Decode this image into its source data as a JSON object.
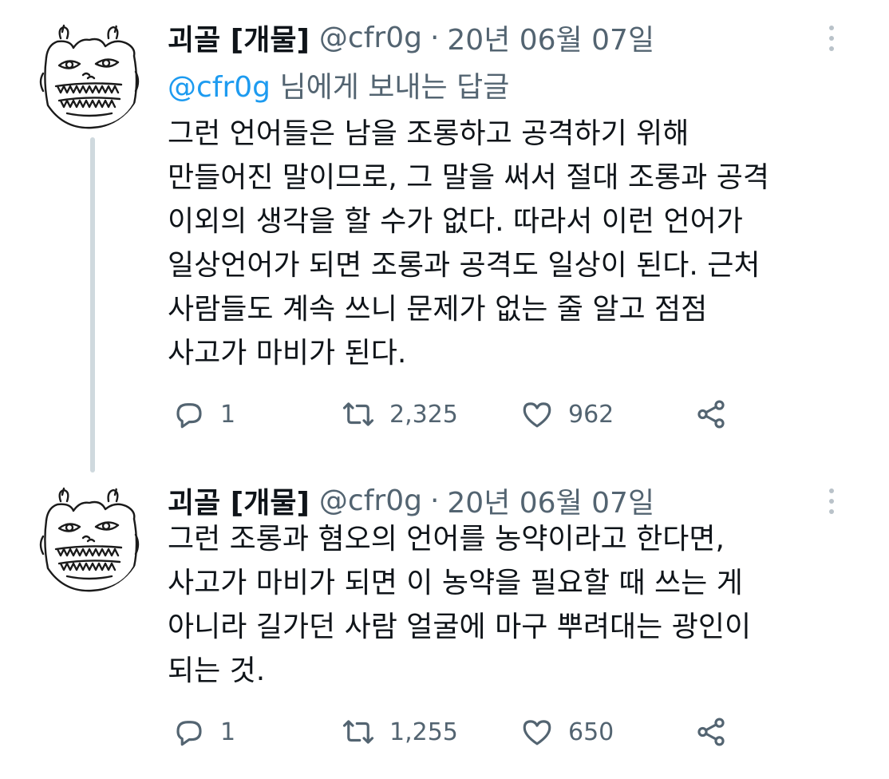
{
  "tweets": [
    {
      "display_name": "괴골 [개물]",
      "handle": "@cfr0g",
      "separator": "·",
      "date": "20년 06월 07일",
      "reply_to": {
        "mention": "@cfr0g",
        "suffix": "님에게 보내는 답글"
      },
      "body_lines": [
        "그런 언어들은 남을 조롱하고 공격하기 위해",
        "만들어진 말이므로, 그 말을 써서 절대 조롱과 공격",
        "이외의 생각을 할 수가 없다. 따라서 이런 언어가",
        "일상언어가 되면 조롱과 공격도 일상이 된다. 근처",
        "사람들도 계속 쓰니 문제가 없는 줄 알고 점점",
        "사고가 마비가 된다."
      ],
      "actions": {
        "replies": "1",
        "retweets": "2,325",
        "likes": "962"
      }
    },
    {
      "display_name": "괴골 [개물]",
      "handle": "@cfr0g",
      "separator": "·",
      "date": "20년 06월 07일",
      "body_lines": [
        "그런 조롱과 혐오의 언어를 농약이라고 한다면,",
        "사고가 마비가 되면 이 농약을 필요할 때 쓰는 게",
        "아니라 길가던 사람 얼굴에 마구 뿌려대는 광인이",
        "되는 것."
      ],
      "actions": {
        "replies": "1",
        "retweets": "1,255",
        "likes": "650"
      }
    }
  ],
  "icons": {
    "reply": "reply-icon",
    "retweet": "retweet-icon",
    "like": "heart-icon",
    "share": "share-icon",
    "more": "more-icon",
    "avatar": "avatar-drawing"
  },
  "colors": {
    "text": "#0f1419",
    "secondary": "#536471",
    "mention": "#1d9bf0",
    "thread_line": "#cfd9de"
  }
}
